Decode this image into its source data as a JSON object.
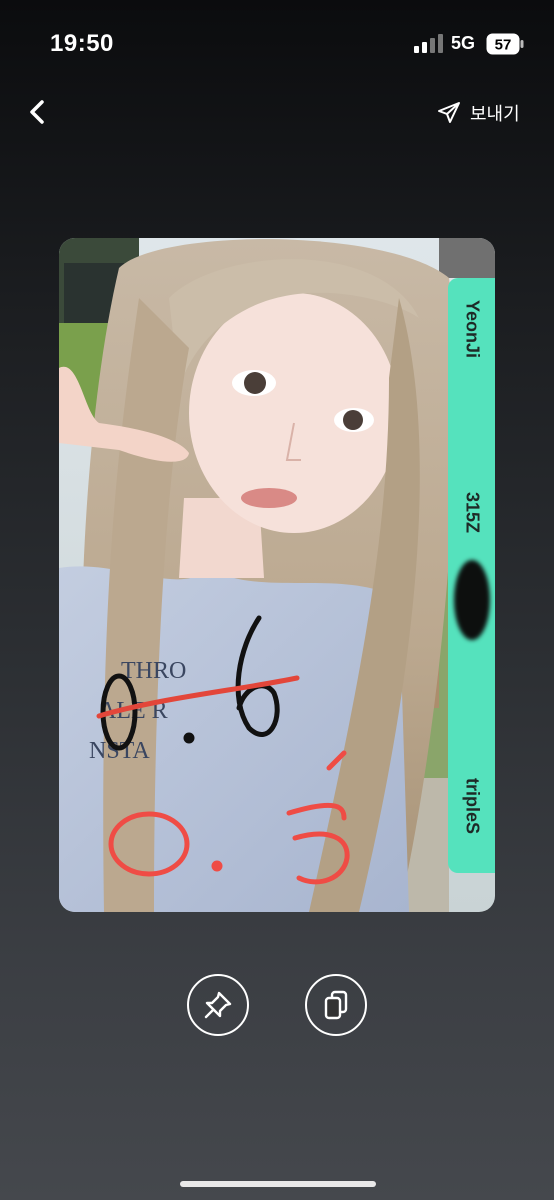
{
  "status_bar": {
    "time": "19:50",
    "network": "5G",
    "battery": "57"
  },
  "nav": {
    "back_icon": "chevron-left-icon",
    "send_icon": "paper-plane-icon",
    "send_label": "보내기"
  },
  "photocard": {
    "member": "YeonJi",
    "serial": "315Z",
    "group": "tripleS",
    "strip_color": "#55e2bd",
    "shirt_text": [
      "THRO",
      "ALE R",
      "NSTA"
    ],
    "old_price_handwritten": "0.6",
    "new_price_handwritten": "0.5"
  },
  "actions": {
    "pin_icon": "pin-icon",
    "copy_icon": "copy-icon"
  }
}
